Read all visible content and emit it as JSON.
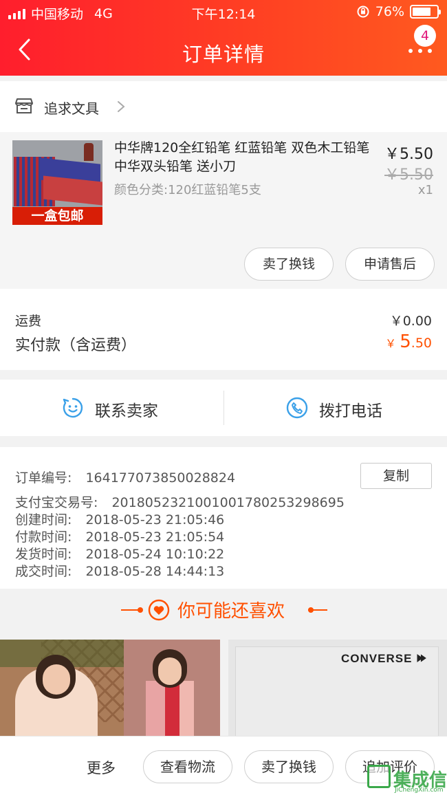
{
  "status_bar": {
    "carrier": "中国移动",
    "network": "4G",
    "time": "下午12:14",
    "battery_percent": "76%",
    "battery_level": 0.76
  },
  "nav": {
    "title": "订单详情",
    "notification_count": "4"
  },
  "shop": {
    "name": "追求文具"
  },
  "item": {
    "title": "中华牌120全红铅笔 红蓝铅笔 双色木工铅笔 中华双头铅笔 送小刀",
    "spec": "颜色分类:120红蓝铅笔5支",
    "thumbnail_banner": "一盒包邮",
    "price": "￥5.50",
    "original_price": "￥5.50",
    "quantity": "x1",
    "sell_button": "卖了换钱",
    "aftersale_button": "申请售后"
  },
  "fees": {
    "shipping_label": "运费",
    "shipping_value": "￥0.00",
    "paid_label": "实付款（含运费）",
    "paid_currency": "￥",
    "paid_int": "5",
    "paid_dec": ".50"
  },
  "contact": {
    "seller_label": "联系卖家",
    "phone_label": "拨打电话"
  },
  "order": {
    "number_label": "订单编号:",
    "number_value": "164177073850028824",
    "copy_button": "复制",
    "alipay_label": "支付宝交易号:",
    "alipay_value": "2018052321001001780253298695",
    "created_label": "创建时间:",
    "created_value": "2018-05-23 21:05:46",
    "paid_label": "付款时间:",
    "paid_value": "2018-05-23 21:05:54",
    "shipped_label": "发货时间:",
    "shipped_value": "2018-05-24 10:10:22",
    "closed_label": "成交时间:",
    "closed_value": "2018-05-28 14:44:13"
  },
  "recommend": {
    "title": "你可能还喜欢",
    "card2_brand": "CONVERSE"
  },
  "bottom_bar": {
    "more": "更多",
    "logistics_button": "查看物流",
    "sell_button": "卖了换钱",
    "review_button": "追加评价"
  },
  "watermark": {
    "text": "集成信",
    "domain": "JiChengXin.com"
  },
  "colors": {
    "header_red": "#ff2b2b",
    "accent_orange": "#ff5000",
    "contact_icon_blue": "#3aa0e8",
    "watermark_green": "#3aa84a"
  }
}
